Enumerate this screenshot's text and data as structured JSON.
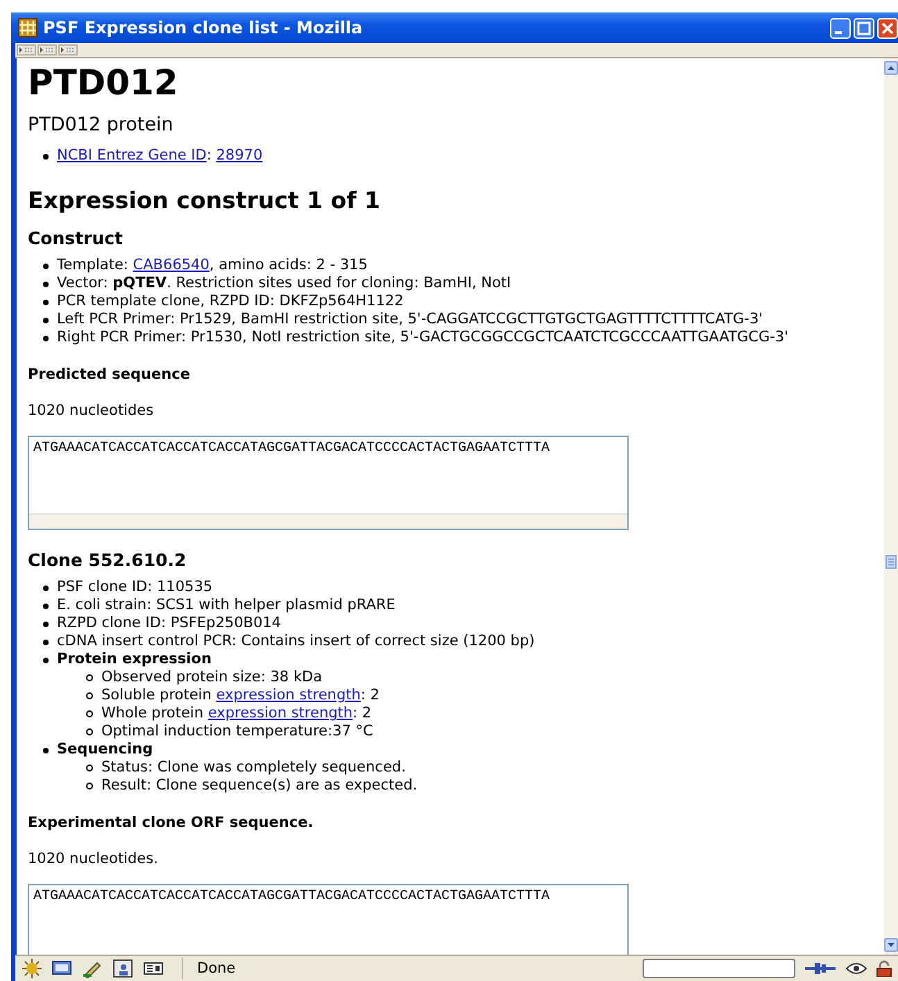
{
  "window": {
    "title": "PSF Expression clone list - Mozilla"
  },
  "page": {
    "title": "PTD012",
    "subtitle": "PTD012 protein",
    "gene_items": [
      {
        "parts": [
          {
            "text": "NCBI Entrez Gene ID",
            "link": true
          },
          {
            "text": ": ",
            "link": false
          },
          {
            "text": "28970",
            "link": true
          }
        ]
      }
    ],
    "construct_heading": "Expression construct 1 of 1",
    "construct": {
      "heading": "Construct",
      "items": [
        {
          "parts": [
            {
              "text": "Template: ",
              "link": false
            },
            {
              "text": "CAB66540",
              "link": true
            },
            {
              "text": ", amino acids: 2 - 315",
              "link": false
            }
          ]
        },
        {
          "parts": [
            {
              "text": "Vector: **pQTEV**. Restriction sites used for cloning: BamHI, NotI",
              "link": false
            }
          ]
        },
        {
          "parts": [
            {
              "text": "PCR template clone, RZPD ID: DKFZp564H1122",
              "link": false
            }
          ]
        },
        {
          "parts": [
            {
              "text": "Left PCR Primer: Pr1529, BamHI restriction site, 5'-CAGGATCCGCTTGTGCTGAGTTTTCTTTTCATG-3'",
              "link": false
            }
          ]
        },
        {
          "parts": [
            {
              "text": "Right PCR Primer: Pr1530, NotI restriction site, 5'-GACTGCGGCCGCTCAATCTCGCCCAATTGAATGCG-3'",
              "link": false
            }
          ]
        }
      ],
      "sequence_heading": "Predicted sequence",
      "sequence_length": "1020 nucleotides",
      "sequence": "ATGAAACATCACCATCACCATCACCATAGCGATTACGACATCCCCACTACTGAGAATCTTTA"
    },
    "clone": {
      "heading": "Clone 552.610.2",
      "items": [
        {
          "parts": [
            {
              "text": "PSF clone ID: 110535",
              "link": false
            }
          ]
        },
        {
          "parts": [
            {
              "text": "E. coli strain: SCS1 with helper plasmid pRARE",
              "link": false
            }
          ]
        },
        {
          "parts": [
            {
              "text": "RZPD clone ID: PSFEp250B014",
              "link": false
            }
          ]
        },
        {
          "parts": [
            {
              "text": "cDNA insert control PCR: Contains insert of correct size (1200 bp)",
              "link": false
            }
          ]
        },
        {
          "parts": [
            {
              "text": "Protein expression",
              "link": false
            }
          ],
          "children": [
            {
              "parts": [
                {
                  "text": "Observed protein size: 38 kDa",
                  "link": false
                }
              ]
            },
            {
              "parts": [
                {
                  "text": "Soluble protein ",
                  "link": false
                },
                {
                  "text": "expression strength",
                  "link": true
                },
                {
                  "text": ": 2",
                  "link": false
                }
              ]
            },
            {
              "parts": [
                {
                  "text": "Whole protein ",
                  "link": false
                },
                {
                  "text": "expression strength",
                  "link": true
                },
                {
                  "text": ": 2",
                  "link": false
                }
              ]
            },
            {
              "parts": [
                {
                  "text": "Optimal induction temperature:37 °C",
                  "link": false
                }
              ]
            }
          ]
        },
        {
          "parts": [
            {
              "text": "Sequencing",
              "link": false
            }
          ],
          "children": [
            {
              "parts": [
                {
                  "text": "Status: Clone was completely sequenced.",
                  "link": false
                }
              ]
            },
            {
              "parts": [
                {
                  "text": "Result: Clone sequence(s) are as expected.",
                  "link": false
                }
              ]
            }
          ]
        }
      ],
      "sequence_heading": "Experimental clone ORF sequence.",
      "sequence_length": "1020 nucleotides.",
      "sequence": "ATGAAACATCACCATCACCATCACCATAGCGATTACGACATCCCCACTACTGAGAATCTTTA"
    }
  },
  "status_bar": {
    "text": "Done"
  }
}
